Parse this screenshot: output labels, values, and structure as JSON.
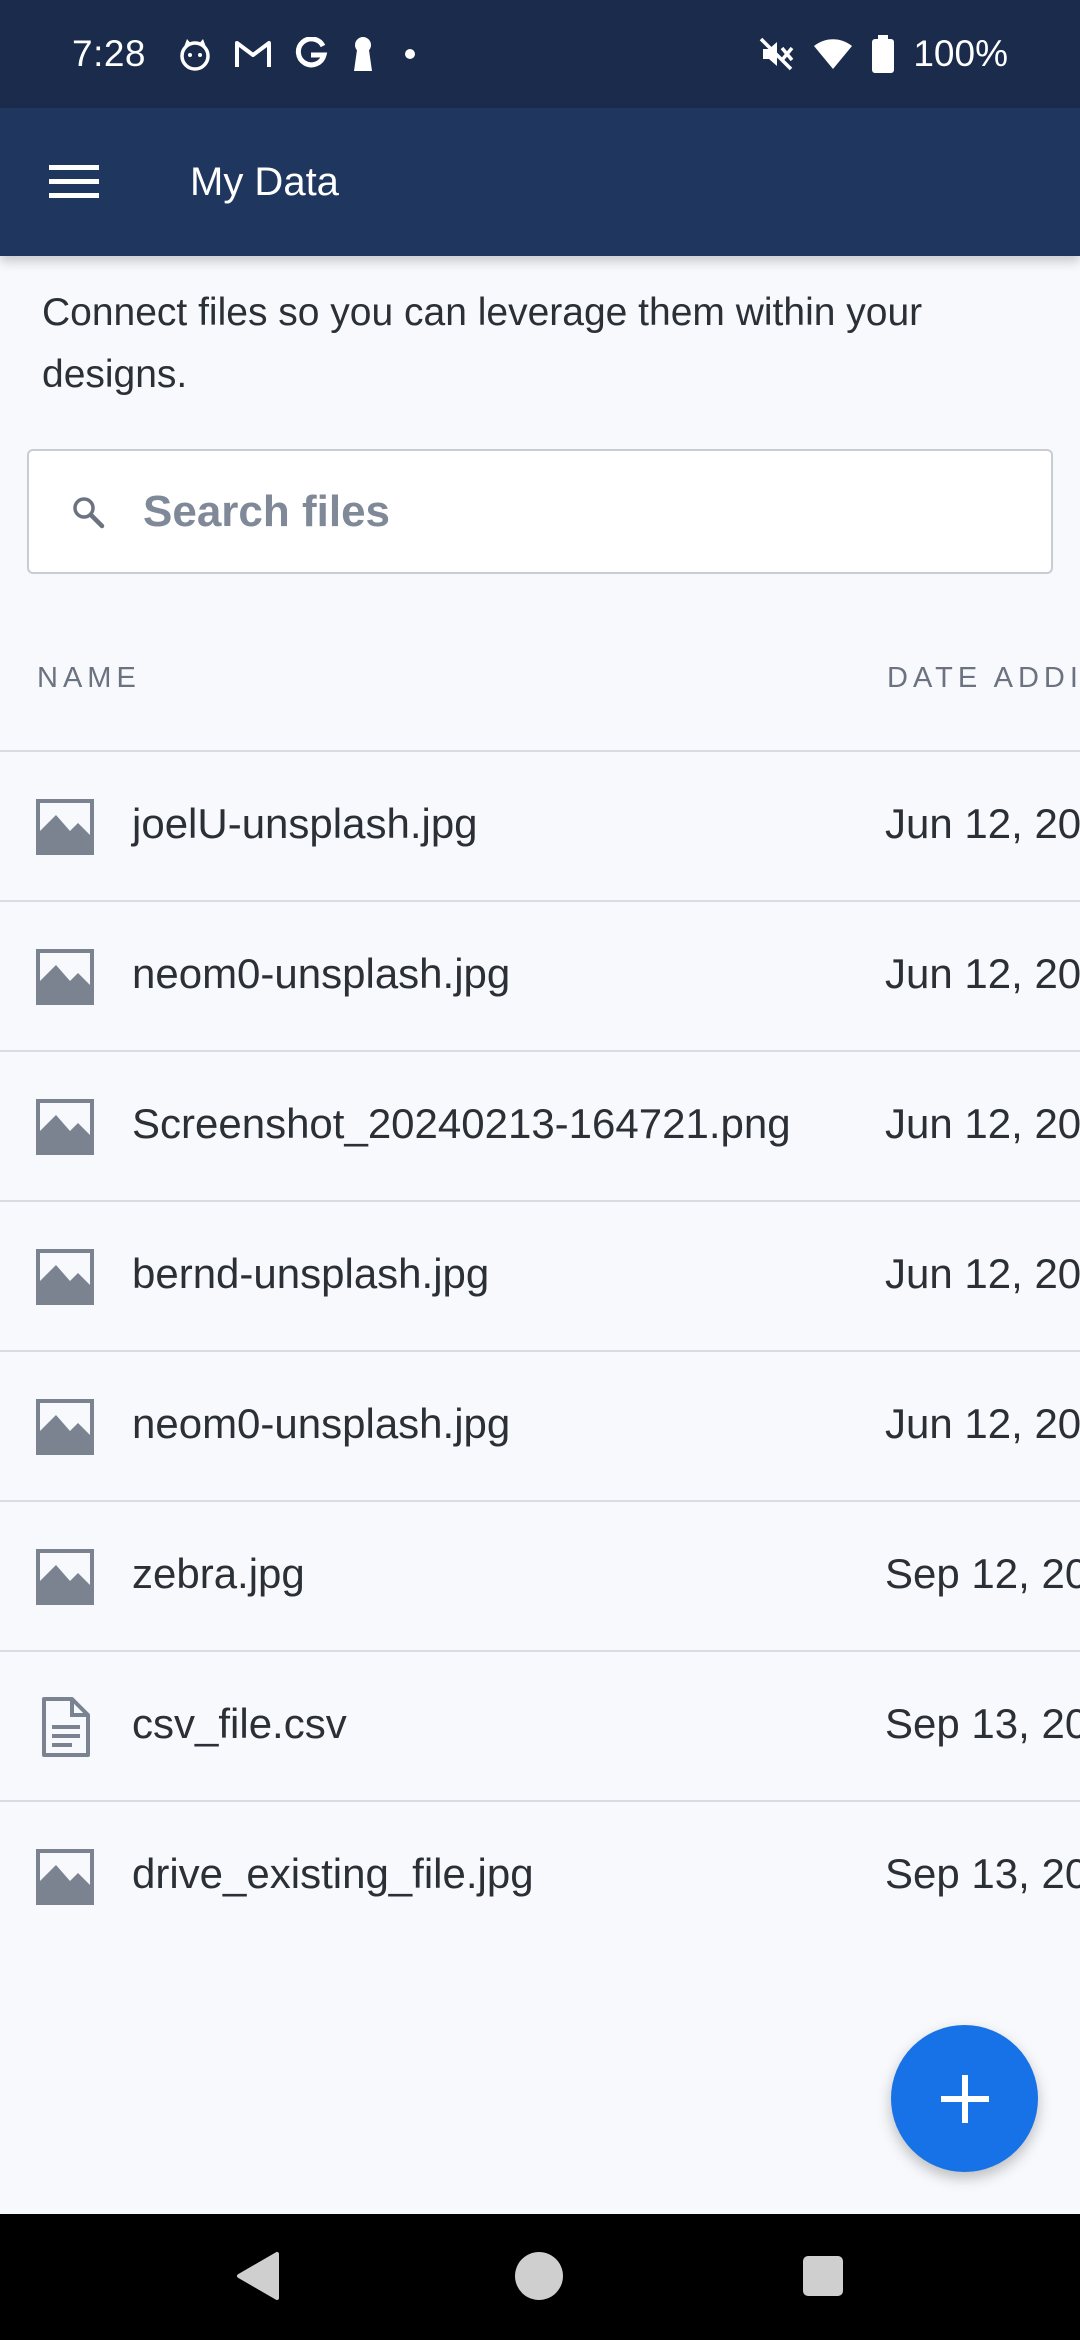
{
  "status_bar": {
    "time": "7:28",
    "notification_icons": [
      "cat-icon",
      "gmail-icon",
      "google-icon",
      "keyhole-icon",
      "dot-icon"
    ],
    "system_icons": [
      "mute-icon",
      "wifi-icon",
      "battery-icon"
    ],
    "battery": "100%"
  },
  "app_bar": {
    "title": "My Data",
    "menu_icon": "hamburger-menu-icon",
    "background": "#1f365f"
  },
  "intro_text": "Connect files so you can leverage them within your designs.",
  "search": {
    "placeholder": "Search files",
    "value": ""
  },
  "table": {
    "columns": [
      "NAME",
      "DATE ADDI"
    ],
    "rows": [
      {
        "name": "joelU-unsplash.jpg",
        "date": "Jun 12, 20",
        "icon": "image-icon"
      },
      {
        "name": "neom0-unsplash.jpg",
        "date": "Jun 12, 20",
        "icon": "image-icon"
      },
      {
        "name": "Screenshot_20240213-164721.png",
        "date": "Jun 12, 20",
        "icon": "image-icon"
      },
      {
        "name": "bernd-unsplash.jpg",
        "date": "Jun 12, 20",
        "icon": "image-icon"
      },
      {
        "name": "neom0-unsplash.jpg",
        "date": "Jun 12, 20",
        "icon": "image-icon"
      },
      {
        "name": "zebra.jpg",
        "date": "Sep 12, 20",
        "icon": "image-icon"
      },
      {
        "name": "csv_file.csv",
        "date": "Sep 13, 20",
        "icon": "document-icon"
      },
      {
        "name": "drive_existing_file.jpg",
        "date": "Sep 13, 20",
        "icon": "image-icon"
      }
    ]
  },
  "fab": {
    "label": "+",
    "color": "#1672e6"
  },
  "nav_bar": [
    "back-icon",
    "home-icon",
    "recents-icon"
  ]
}
